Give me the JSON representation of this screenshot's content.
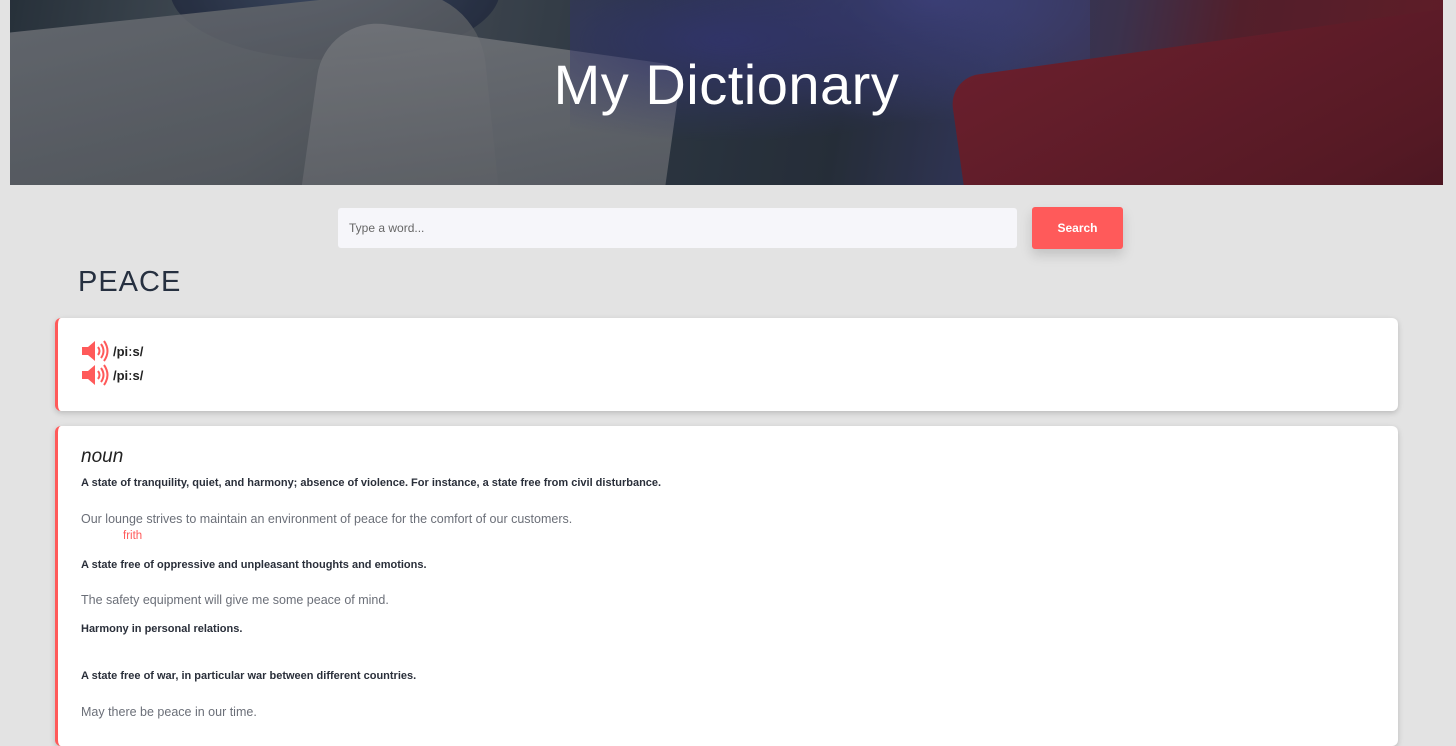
{
  "header": {
    "title": "My Dictionary"
  },
  "search": {
    "placeholder": "Type a word...",
    "value": "",
    "button_label": "Search"
  },
  "result": {
    "word": "PEACE",
    "phonetics": [
      {
        "text": "/piːs/",
        "icon": "speaker-icon"
      },
      {
        "text": "/piːs/",
        "icon": "speaker-icon"
      }
    ],
    "meaning": {
      "part_of_speech": "noun",
      "definitions": [
        {
          "definition": "A state of tranquility, quiet, and harmony; absence of violence. For instance, a state free from civil disturbance.",
          "example": "Our lounge strives to maintain an environment of peace for the comfort of our customers.",
          "synonym": "frith"
        },
        {
          "definition": "A state free of oppressive and unpleasant thoughts and emotions.",
          "example": "The safety equipment will give me some peace of mind."
        },
        {
          "definition": "Harmony in personal relations."
        },
        {
          "definition": "A state free of war, in particular war between different countries.",
          "example": "May there be peace in our time."
        }
      ]
    }
  },
  "colors": {
    "accent": "#ff5a5a",
    "background": "#e3e3e3",
    "card": "#ffffff",
    "title": "#263040"
  }
}
